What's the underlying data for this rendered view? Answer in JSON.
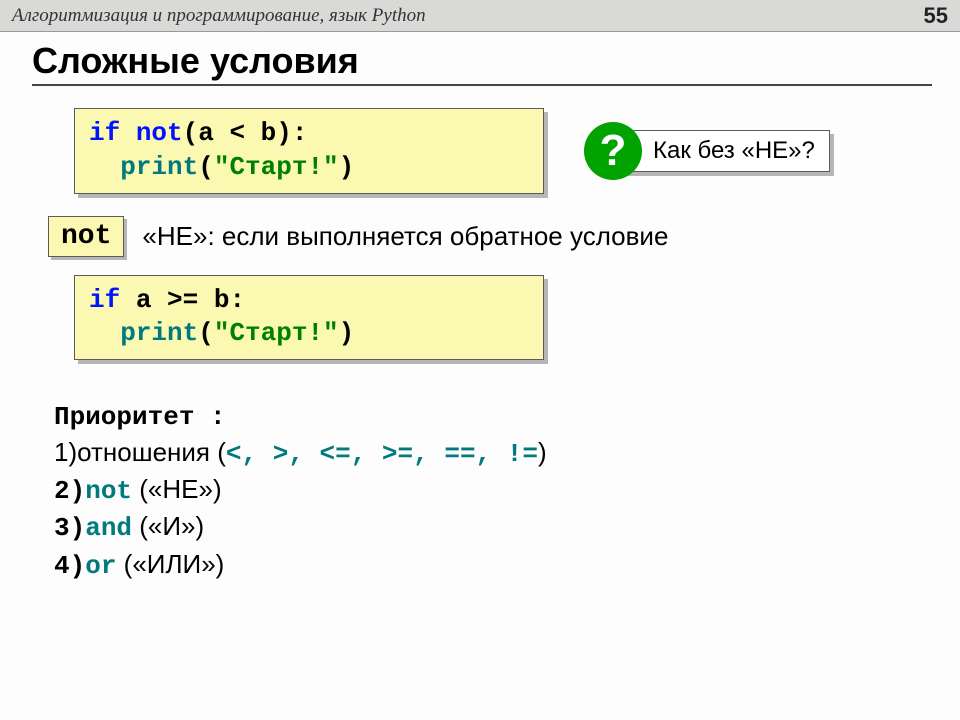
{
  "header": {
    "title": "Алгоритмизация и программирование, язык Python",
    "page_number": "55"
  },
  "slide_title": "Сложные условия",
  "code1": {
    "kw_if": "if",
    "kw_not": "not",
    "expr": "(a < b):",
    "fn_print": "print",
    "paren_open": "(",
    "str": "\"Старт!\"",
    "paren_close": ")"
  },
  "callout": {
    "mark": "?",
    "text": "Как без «НЕ»?"
  },
  "badge_not": "not",
  "not_desc": "«НЕ»: если выполняется обратное условие",
  "code2": {
    "kw_if": "if",
    "expr": "a >= b:",
    "fn_print": "print",
    "paren_open": "(",
    "str": "\"Старт!\"",
    "paren_close": ")"
  },
  "priority": {
    "header": "Приоритет :",
    "l1_pre": "1)отношения (",
    "l1_ops": "<, >, <=, >=, ==, !=",
    "l1_post": ")",
    "l2_num": "2)",
    "l2_kw": "not",
    "l2_desc": " («НЕ»)",
    "l3_num": "3)",
    "l3_kw": "and",
    "l3_desc": " («И»)",
    "l4_num": "4)",
    "l4_kw": "or",
    "l4_desc": " («ИЛИ»)"
  }
}
